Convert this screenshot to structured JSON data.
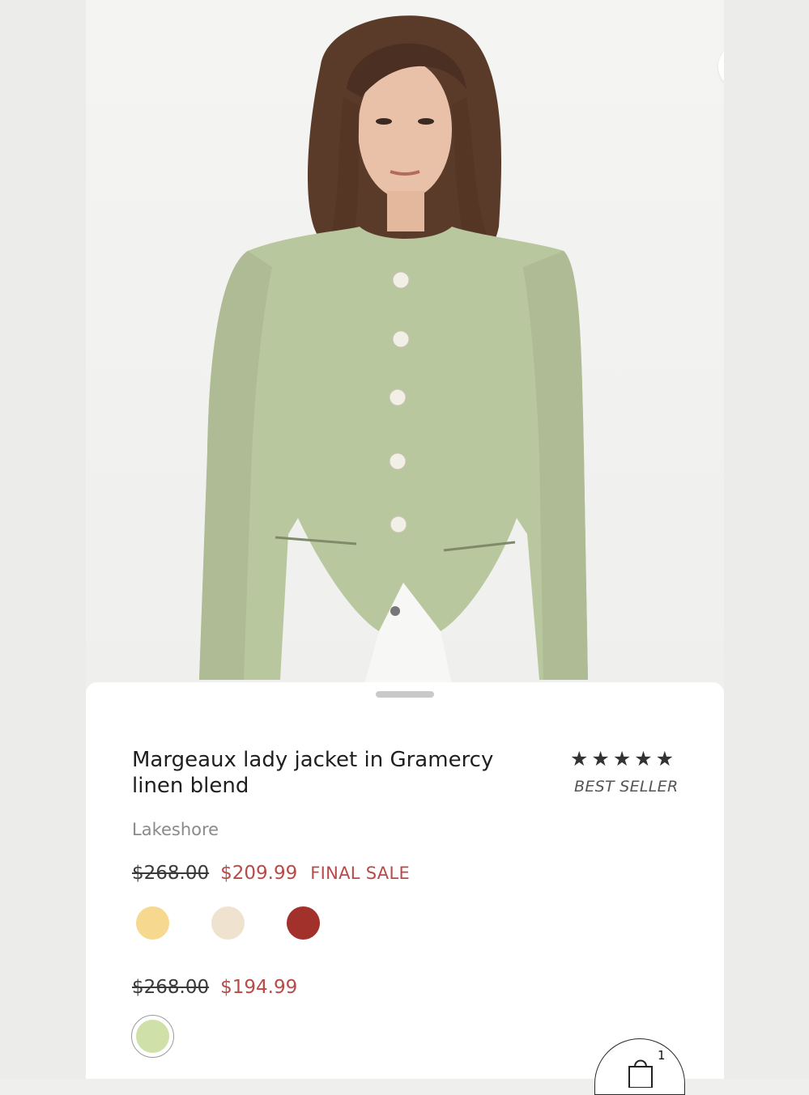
{
  "product": {
    "title": "Margeaux lady jacket in Gramercy linen blend",
    "rating_stars": "★★★★★",
    "badge": "BEST SELLER",
    "brand": "Lakeshore"
  },
  "gallery": {
    "image_count": 5,
    "active_index": 0
  },
  "pricing": [
    {
      "original": "$268.00",
      "sale": "$209.99",
      "tag": "FINAL SALE",
      "swatches": [
        "#f6d98f",
        "#efe3cf",
        "#a2302b"
      ]
    },
    {
      "original": "$268.00",
      "sale": "$194.99",
      "tag": "",
      "swatches": [
        "#cfe1a8"
      ]
    }
  ],
  "cart": {
    "count": "1"
  },
  "colors": {
    "sale_red": "#b84a48",
    "jacket_sage": "#b9c79f"
  },
  "icons": {
    "close": "close-icon",
    "bag": "shopping-bag-icon"
  }
}
